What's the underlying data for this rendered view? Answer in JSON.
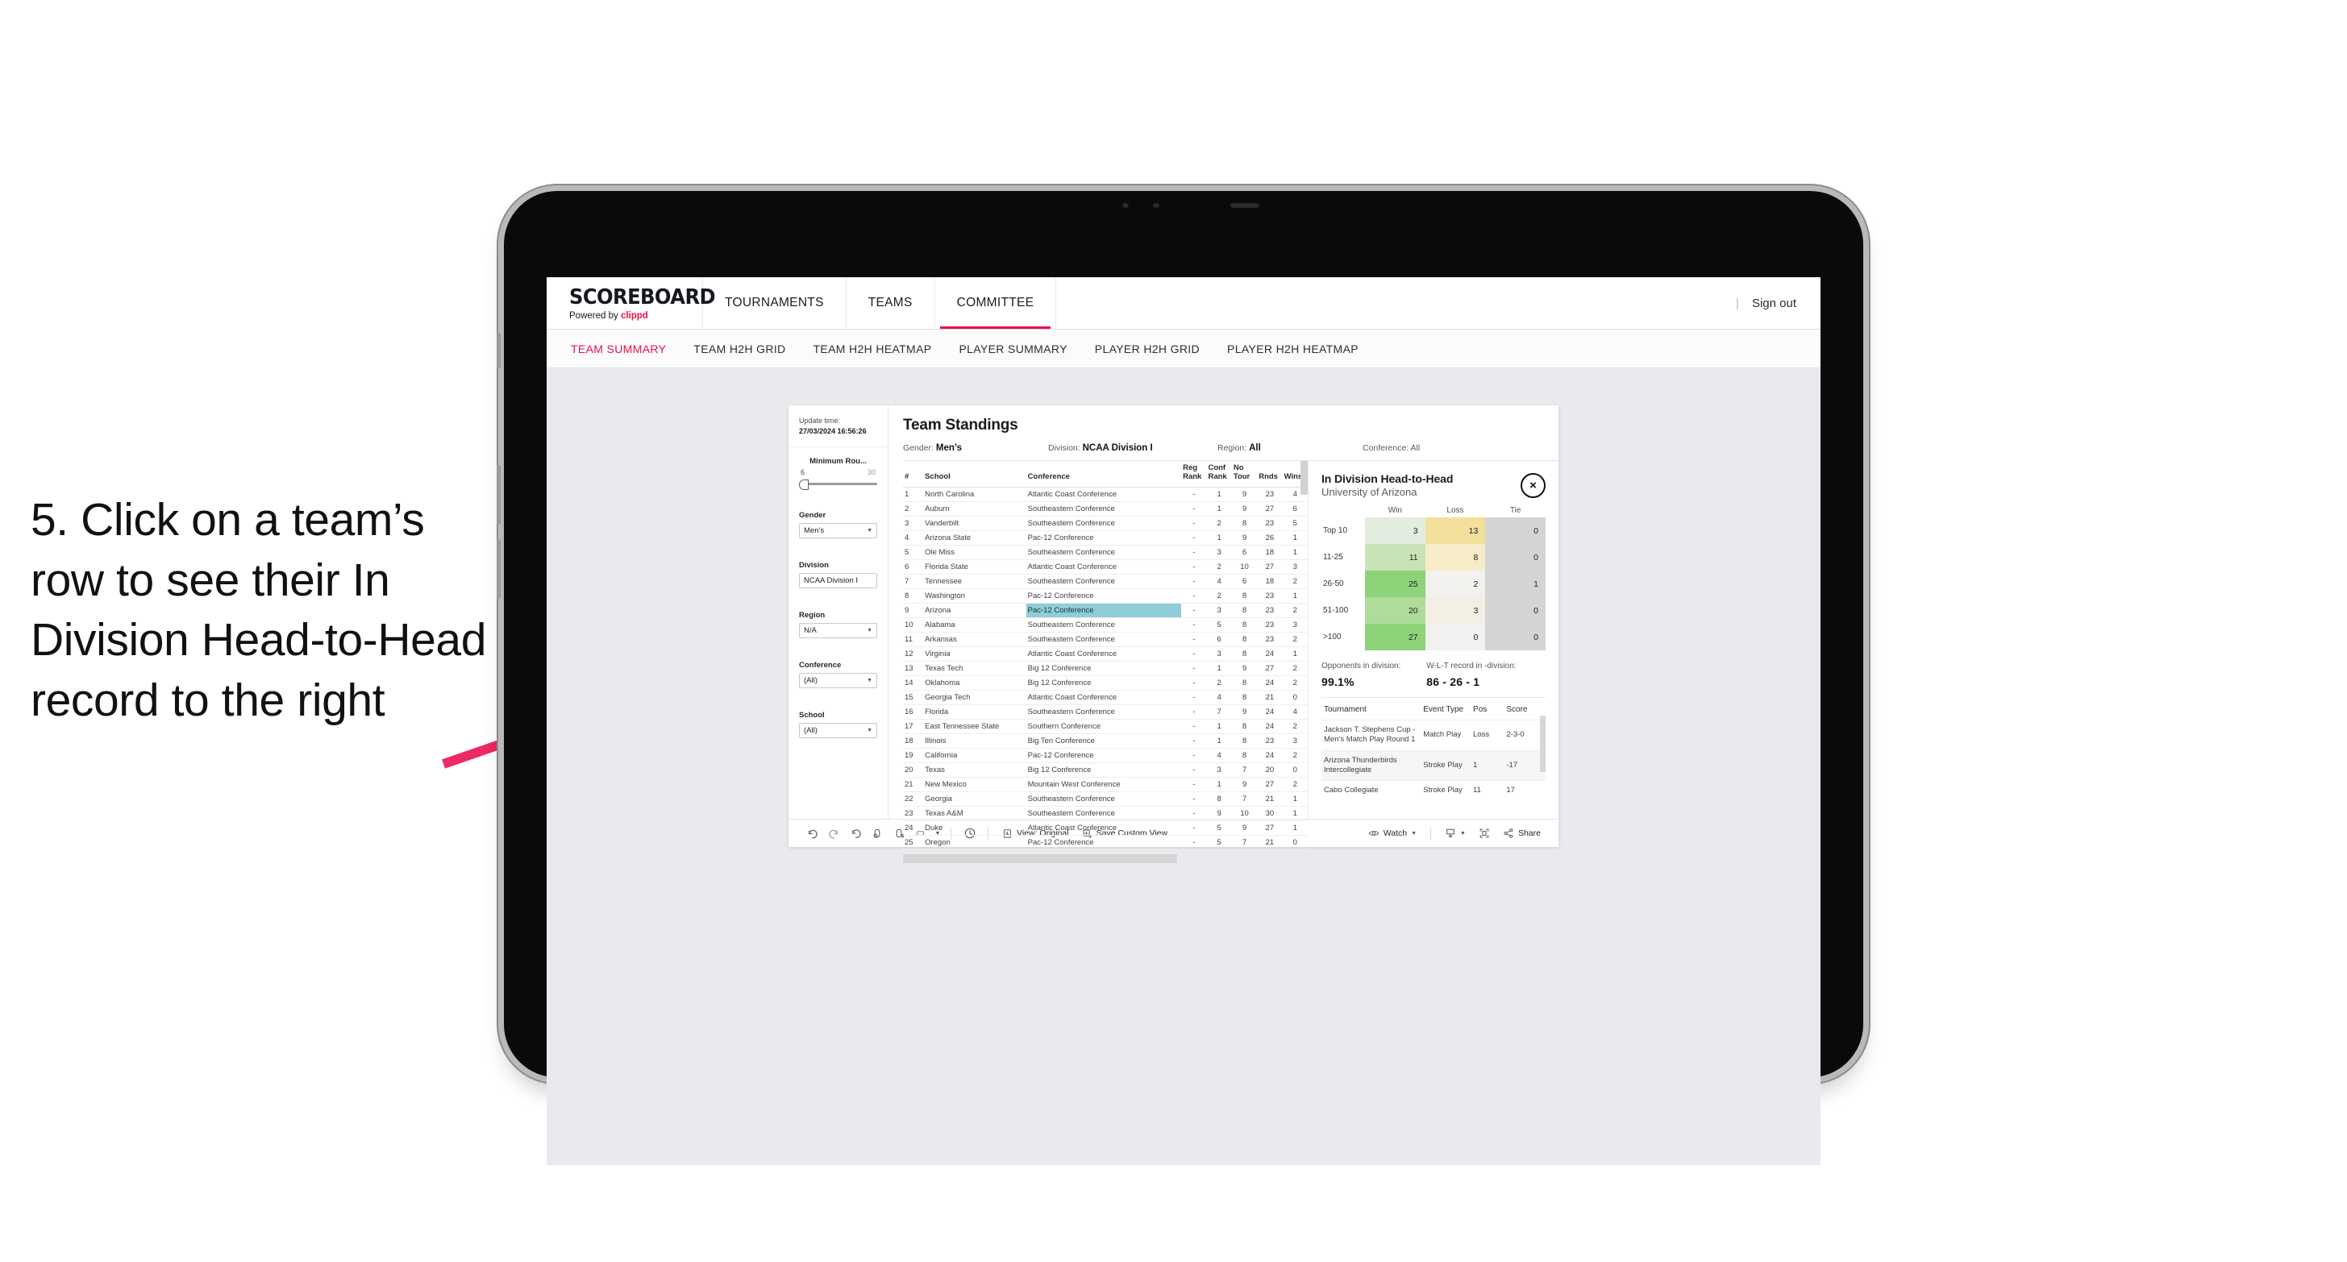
{
  "annotation": {
    "text": "5. Click on a team’s row to see their In Division Head-to-Head record to the right",
    "arrow_color": "#ec2a63"
  },
  "app": {
    "brand": {
      "title": "SCOREBOARD",
      "powered_prefix": "Powered by ",
      "powered_name": "clippd"
    },
    "nav": [
      {
        "label": "TOURNAMENTS",
        "active": false
      },
      {
        "label": "TEAMS",
        "active": false
      },
      {
        "label": "COMMITTEE",
        "active": true
      }
    ],
    "sign_out": "Sign out",
    "subnav": [
      {
        "label": "TEAM SUMMARY",
        "active": true
      },
      {
        "label": "TEAM H2H GRID",
        "active": false
      },
      {
        "label": "TEAM H2H HEATMAP",
        "active": false
      },
      {
        "label": "PLAYER SUMMARY",
        "active": false
      },
      {
        "label": "PLAYER H2H GRID",
        "active": false
      },
      {
        "label": "PLAYER H2H HEATMAP",
        "active": false
      }
    ]
  },
  "filters": {
    "update_time_label": "Update time:",
    "update_time_value": "27/03/2024 16:56:26",
    "min_rounds": {
      "label": "Minimum Rou...",
      "min": "6",
      "max": "30"
    },
    "gender": {
      "label": "Gender",
      "value": "Men’s"
    },
    "division": {
      "label": "Division",
      "value": "NCAA Division I"
    },
    "region": {
      "label": "Region",
      "value": "N/A"
    },
    "conference": {
      "label": "Conference",
      "value": "(All)"
    },
    "school": {
      "label": "School",
      "value": "(All)"
    }
  },
  "standings": {
    "title": "Team Standings",
    "meta": {
      "gender_label": "Gender:",
      "gender_value": "Men’s",
      "division_label": "Division:",
      "division_value": "NCAA Division I",
      "region_label": "Region:",
      "region_value": "All",
      "conference_label": "Conference:",
      "conference_value": "All"
    },
    "columns": [
      "#",
      "School",
      "Conference",
      "Reg Rank",
      "Conf Rank",
      "No Tour",
      "Rnds",
      "Wins"
    ],
    "rows": [
      {
        "n": "1",
        "school": "North Carolina",
        "conf": "Atlantic Coast Conference",
        "reg": "-",
        "crank": "1",
        "notour": "9",
        "rnds": "23",
        "wins": "4",
        "selected": false
      },
      {
        "n": "2",
        "school": "Auburn",
        "conf": "Southeastern Conference",
        "reg": "-",
        "crank": "1",
        "notour": "9",
        "rnds": "27",
        "wins": "6",
        "selected": false
      },
      {
        "n": "3",
        "school": "Vanderbilt",
        "conf": "Southeastern Conference",
        "reg": "-",
        "crank": "2",
        "notour": "8",
        "rnds": "23",
        "wins": "5",
        "selected": false
      },
      {
        "n": "4",
        "school": "Arizona State",
        "conf": "Pac-12 Conference",
        "reg": "-",
        "crank": "1",
        "notour": "9",
        "rnds": "26",
        "wins": "1",
        "selected": false
      },
      {
        "n": "5",
        "school": "Ole Miss",
        "conf": "Southeastern Conference",
        "reg": "-",
        "crank": "3",
        "notour": "6",
        "rnds": "18",
        "wins": "1",
        "selected": false
      },
      {
        "n": "6",
        "school": "Florida State",
        "conf": "Atlantic Coast Conference",
        "reg": "-",
        "crank": "2",
        "notour": "10",
        "rnds": "27",
        "wins": "3",
        "selected": false
      },
      {
        "n": "7",
        "school": "Tennessee",
        "conf": "Southeastern Conference",
        "reg": "-",
        "crank": "4",
        "notour": "6",
        "rnds": "18",
        "wins": "2",
        "selected": false
      },
      {
        "n": "8",
        "school": "Washington",
        "conf": "Pac-12 Conference",
        "reg": "-",
        "crank": "2",
        "notour": "8",
        "rnds": "23",
        "wins": "1",
        "selected": false
      },
      {
        "n": "9",
        "school": "Arizona",
        "conf": "Pac-12 Conference",
        "reg": "-",
        "crank": "3",
        "notour": "8",
        "rnds": "23",
        "wins": "2",
        "selected": true
      },
      {
        "n": "10",
        "school": "Alabama",
        "conf": "Southeastern Conference",
        "reg": "-",
        "crank": "5",
        "notour": "8",
        "rnds": "23",
        "wins": "3",
        "selected": false
      },
      {
        "n": "11",
        "school": "Arkansas",
        "conf": "Southeastern Conference",
        "reg": "-",
        "crank": "6",
        "notour": "8",
        "rnds": "23",
        "wins": "2",
        "selected": false
      },
      {
        "n": "12",
        "school": "Virginia",
        "conf": "Atlantic Coast Conference",
        "reg": "-",
        "crank": "3",
        "notour": "8",
        "rnds": "24",
        "wins": "1",
        "selected": false
      },
      {
        "n": "13",
        "school": "Texas Tech",
        "conf": "Big 12 Conference",
        "reg": "-",
        "crank": "1",
        "notour": "9",
        "rnds": "27",
        "wins": "2",
        "selected": false
      },
      {
        "n": "14",
        "school": "Oklahoma",
        "conf": "Big 12 Conference",
        "reg": "-",
        "crank": "2",
        "notour": "8",
        "rnds": "24",
        "wins": "2",
        "selected": false
      },
      {
        "n": "15",
        "school": "Georgia Tech",
        "conf": "Atlantic Coast Conference",
        "reg": "-",
        "crank": "4",
        "notour": "8",
        "rnds": "21",
        "wins": "0",
        "selected": false
      },
      {
        "n": "16",
        "school": "Florida",
        "conf": "Southeastern Conference",
        "reg": "-",
        "crank": "7",
        "notour": "9",
        "rnds": "24",
        "wins": "4",
        "selected": false
      },
      {
        "n": "17",
        "school": "East Tennessee State",
        "conf": "Southern Conference",
        "reg": "-",
        "crank": "1",
        "notour": "8",
        "rnds": "24",
        "wins": "2",
        "selected": false
      },
      {
        "n": "18",
        "school": "Illinois",
        "conf": "Big Ten Conference",
        "reg": "-",
        "crank": "1",
        "notour": "8",
        "rnds": "23",
        "wins": "3",
        "selected": false
      },
      {
        "n": "19",
        "school": "California",
        "conf": "Pac-12 Conference",
        "reg": "-",
        "crank": "4",
        "notour": "8",
        "rnds": "24",
        "wins": "2",
        "selected": false
      },
      {
        "n": "20",
        "school": "Texas",
        "conf": "Big 12 Conference",
        "reg": "-",
        "crank": "3",
        "notour": "7",
        "rnds": "20",
        "wins": "0",
        "selected": false
      },
      {
        "n": "21",
        "school": "New Mexico",
        "conf": "Mountain West Conference",
        "reg": "-",
        "crank": "1",
        "notour": "9",
        "rnds": "27",
        "wins": "2",
        "selected": false
      },
      {
        "n": "22",
        "school": "Georgia",
        "conf": "Southeastern Conference",
        "reg": "-",
        "crank": "8",
        "notour": "7",
        "rnds": "21",
        "wins": "1",
        "selected": false
      },
      {
        "n": "23",
        "school": "Texas A&M",
        "conf": "Southeastern Conference",
        "reg": "-",
        "crank": "9",
        "notour": "10",
        "rnds": "30",
        "wins": "1",
        "selected": false
      },
      {
        "n": "24",
        "school": "Duke",
        "conf": "Atlantic Coast Conference",
        "reg": "-",
        "crank": "5",
        "notour": "9",
        "rnds": "27",
        "wins": "1",
        "selected": false
      },
      {
        "n": "25",
        "school": "Oregon",
        "conf": "Pac-12 Conference",
        "reg": "-",
        "crank": "5",
        "notour": "7",
        "rnds": "21",
        "wins": "0",
        "selected": false
      }
    ]
  },
  "h2h": {
    "title": "In Division Head-to-Head",
    "subtitle": "University of Arizona",
    "close_icon": "×",
    "matrix_headers": [
      "",
      "Win",
      "Loss",
      "Tie"
    ],
    "matrix_rows": [
      {
        "band": "Top 10",
        "win": "3",
        "loss": "13",
        "tie": "0",
        "win_color": "#e2ecdf",
        "loss_color": "#f2e09c",
        "tie_color": "#d4d4d4"
      },
      {
        "band": "11-25",
        "win": "11",
        "loss": "8",
        "tie": "0",
        "win_color": "#c9e3b8",
        "loss_color": "#f6ecc8",
        "tie_color": "#d4d4d4"
      },
      {
        "band": "26-50",
        "win": "25",
        "loss": "2",
        "tie": "1",
        "win_color": "#8ed37a",
        "loss_color": "#f1f1ed",
        "tie_color": "#d4d4d4"
      },
      {
        "band": "51-100",
        "win": "20",
        "loss": "3",
        "tie": "0",
        "win_color": "#b0dc9a",
        "loss_color": "#f3efe4",
        "tie_color": "#d4d4d4"
      },
      {
        "band": ">100",
        "win": "27",
        "loss": "0",
        "tie": "0",
        "win_color": "#8ed37a",
        "loss_color": "#f1f1ef",
        "tie_color": "#d4d4d4"
      }
    ],
    "kpis": [
      {
        "label": "Opponents in division:",
        "value": "99.1%"
      },
      {
        "label": "W-L-T record in -division:",
        "value": "86 - 26 - 1"
      }
    ],
    "tournament_columns": [
      "Tournament",
      "Event Type",
      "Pos",
      "Score"
    ],
    "tournaments": [
      {
        "name": "Jackson T. Stephens Cup - Men’s Match Play Round 1",
        "type": "Match Play",
        "pos": "Loss",
        "score": "2-3-0"
      },
      {
        "name": "Arizona Thunderbirds Intercollegiate",
        "type": "Stroke Play",
        "pos": "1",
        "score": "-17"
      },
      {
        "name": "Cabo Collegiate",
        "type": "Stroke Play",
        "pos": "11",
        "score": "17"
      }
    ]
  },
  "toolbar": {
    "icons": [
      "undo-icon",
      "redo-icon",
      "revert-icon",
      "refresh-data-icon",
      "pause-updates-icon",
      "region-select-icon"
    ],
    "view_label": "View: Original",
    "save_label": "Save Custom View",
    "watch_label": "Watch",
    "share_label": "Share"
  },
  "chart_data": {
    "type": "heatmap",
    "title": "In Division Head-to-Head",
    "subtitle": "University of Arizona",
    "xlabel": "",
    "ylabel": "",
    "columns": [
      "Win",
      "Loss",
      "Tie"
    ],
    "categories": [
      "Top 10",
      "11-25",
      "26-50",
      "51-100",
      ">100"
    ],
    "series": [
      {
        "name": "Win",
        "values": [
          3,
          11,
          25,
          20,
          27
        ]
      },
      {
        "name": "Loss",
        "values": [
          13,
          8,
          2,
          3,
          0
        ]
      },
      {
        "name": "Tie",
        "values": [
          0,
          0,
          1,
          0,
          0
        ]
      }
    ],
    "totals": {
      "wins": 86,
      "losses": 26,
      "ties": 1,
      "record": "86 - 26 - 1",
      "opponents_in_division_pct": 99.1
    },
    "legend": "position"
  }
}
